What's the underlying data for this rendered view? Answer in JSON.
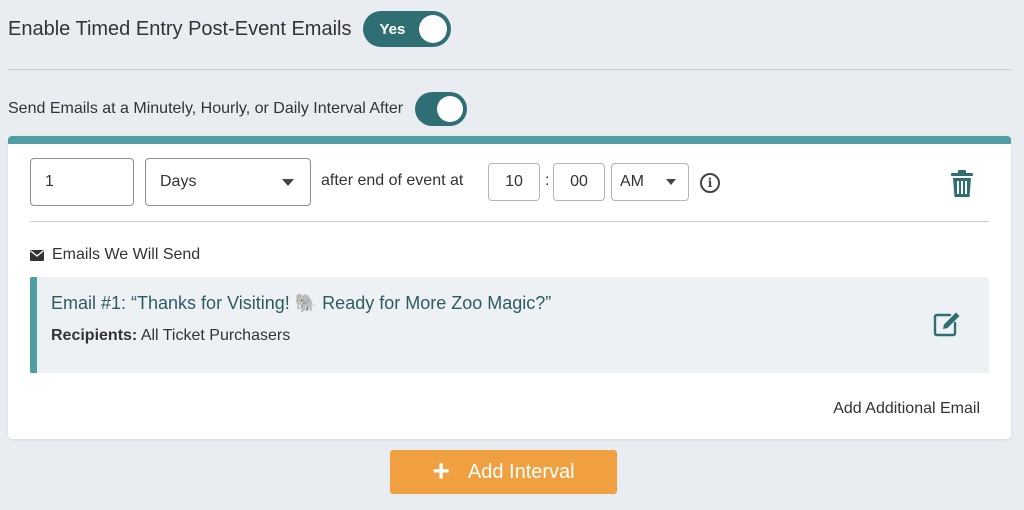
{
  "header": {
    "enable_label": "Enable Timed Entry Post-Event Emails",
    "enable_toggle_label": "Yes",
    "interval_label": "Send Emails at a Minutely, Hourly, or Daily Interval After"
  },
  "interval": {
    "amount": "1",
    "unit": "Days",
    "after_text": "after end of event at",
    "hour": "10",
    "colon": ":",
    "minute": "00",
    "ampm": "AM",
    "emails_heading": "Emails We Will Send",
    "email": {
      "title": "Email #1: “Thanks for Visiting! 🐘 Ready for More Zoo Magic?”",
      "recipients_label": "Recipients:",
      "recipients_value": "All Ticket Purchasers"
    },
    "add_email_label": "Add Additional Email"
  },
  "footer": {
    "add_interval_label": "Add Interval",
    "plus_glyph": "+"
  },
  "colors": {
    "toggle": "#2f6f73",
    "accent_teal": "#4e9ea3",
    "button_orange": "#f0a040",
    "email_title": "#2c5c63"
  },
  "icons": [
    "info-icon",
    "trash-icon",
    "envelope-icon",
    "edit-icon",
    "plus-icon",
    "caret-down-icon"
  ]
}
